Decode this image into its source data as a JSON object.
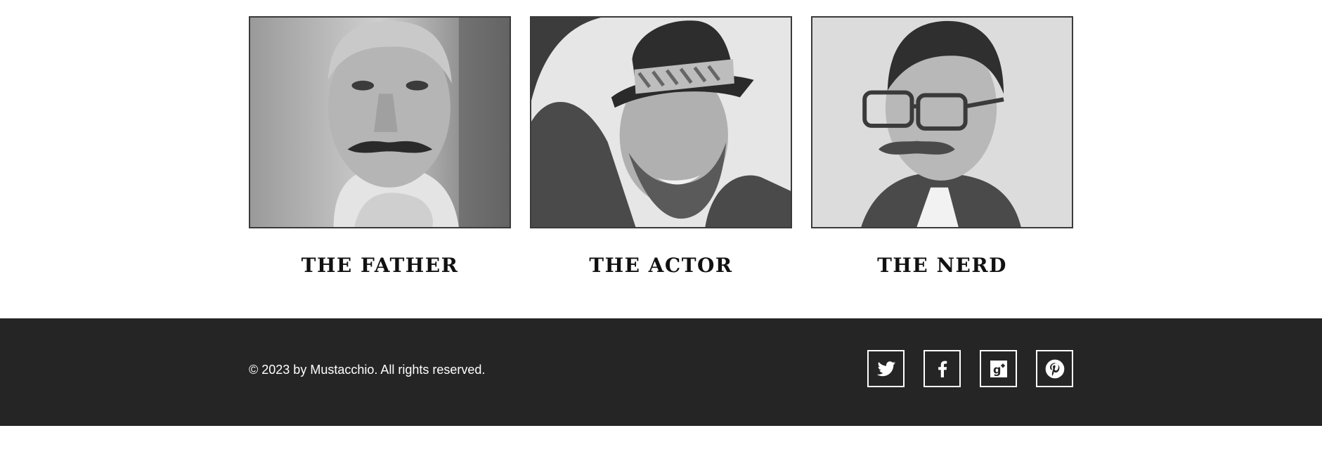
{
  "gallery": {
    "items": [
      {
        "caption": "THE FATHER",
        "image_icon": "portrait-older-man-mustache"
      },
      {
        "caption": "THE ACTOR",
        "image_icon": "portrait-man-in-fedora"
      },
      {
        "caption": "THE NERD",
        "image_icon": "portrait-man-with-glasses"
      }
    ]
  },
  "footer": {
    "copyright": "© 2023 by Mustacchio. All rights reserved.",
    "social": [
      {
        "icon": "twitter-icon"
      },
      {
        "icon": "facebook-icon"
      },
      {
        "icon": "google-plus-icon"
      },
      {
        "icon": "pinterest-icon"
      }
    ],
    "background": "#252525",
    "text_color": "#ffffff"
  }
}
